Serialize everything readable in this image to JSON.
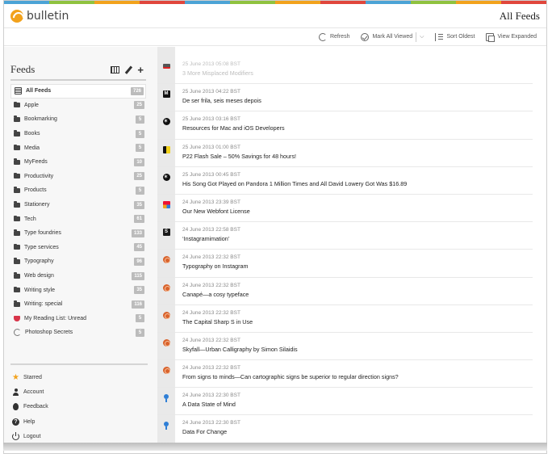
{
  "app": {
    "name": "bulletin",
    "page_title": "All Feeds",
    "stripe_colors": [
      "#4ba3d6",
      "#8fc23f",
      "#f2a21c",
      "#e0463c",
      "#4ba3d6",
      "#8fc23f",
      "#f2a21c",
      "#e0463c",
      "#4ba3d6",
      "#8fc23f",
      "#f2a21c",
      "#e0463c"
    ]
  },
  "toolbar": {
    "refresh": "Refresh",
    "mark_all_viewed": "Mark All Viewed",
    "sort_oldest": "Sort Oldest",
    "view_expanded": "View Expanded"
  },
  "sidebar": {
    "title": "Feeds",
    "items": [
      {
        "label": "All Feeds",
        "count": "726",
        "icon": "all-feeds-icon"
      },
      {
        "label": "Apple",
        "count": "25",
        "icon": "folder-icon"
      },
      {
        "label": "Bookmarking",
        "count": "5",
        "icon": "folder-icon"
      },
      {
        "label": "Books",
        "count": "5",
        "icon": "folder-icon"
      },
      {
        "label": "Media",
        "count": "5",
        "icon": "folder-icon"
      },
      {
        "label": "MyFeeds",
        "count": "10",
        "icon": "folder-icon"
      },
      {
        "label": "Productivity",
        "count": "25",
        "icon": "folder-icon"
      },
      {
        "label": "Products",
        "count": "5",
        "icon": "folder-icon"
      },
      {
        "label": "Stationery",
        "count": "35",
        "icon": "folder-icon"
      },
      {
        "label": "Tech",
        "count": "61",
        "icon": "folder-icon"
      },
      {
        "label": "Type foundries",
        "count": "133",
        "icon": "folder-icon"
      },
      {
        "label": "Type services",
        "count": "45",
        "icon": "folder-icon"
      },
      {
        "label": "Typography",
        "count": "96",
        "icon": "folder-icon"
      },
      {
        "label": "Web design",
        "count": "115",
        "icon": "folder-icon"
      },
      {
        "label": "Writing style",
        "count": "35",
        "icon": "folder-icon"
      },
      {
        "label": "Writing: special",
        "count": "116",
        "icon": "folder-icon"
      },
      {
        "label": "My Reading List: Unread",
        "count": "5",
        "icon": "pocket-icon"
      },
      {
        "label": "Photoshop Secrets",
        "count": "5",
        "icon": "photoshop-secrets-icon"
      }
    ],
    "bottom": [
      {
        "label": "Starred",
        "icon": "star-icon"
      },
      {
        "label": "Account",
        "icon": "account-icon"
      },
      {
        "label": "Feedback",
        "icon": "bug-icon"
      },
      {
        "label": "Help",
        "icon": "help-icon"
      },
      {
        "label": "Logout",
        "icon": "logout-icon"
      }
    ]
  },
  "articles": [
    {
      "date": "25 June 2013 05:08 BST",
      "title": "3 More Misplaced Modifiers",
      "icon": "wide-source-icon"
    },
    {
      "date": "25 June 2013 04:22 BST",
      "title": "De ser frila, seis meses depois",
      "icon": "m-source-icon"
    },
    {
      "date": "25 June 2013 03:16 BST",
      "title": "Resources for Mac and iOS Developers",
      "icon": "star-source-icon"
    },
    {
      "date": "25 June 2013 01:00 BST",
      "title": "P22 Flash Sale – 50% Savings for 48 hours!",
      "icon": "flag-source-icon"
    },
    {
      "date": "25 June 2013 00:45 BST",
      "title": "His Song Got Played on Pandora 1 Million Times and All David Lowery Got Was $16.89",
      "icon": "star-source-icon"
    },
    {
      "date": "24 June 2013 23:39 BST",
      "title": "Our New Webfont License",
      "icon": "multicolor-source-icon"
    },
    {
      "date": "24 June 2013 22:58 BST",
      "title": "‘Instagramimation’",
      "icon": "s-source-icon"
    },
    {
      "date": "24 June 2013 22:32 BST",
      "title": "Typography on Instagram",
      "icon": "type-source-icon"
    },
    {
      "date": "24 June 2013 22:32 BST",
      "title": "Canapé—a cosy typeface",
      "icon": "type-source-icon"
    },
    {
      "date": "24 June 2013 22:32 BST",
      "title": "The Capital Sharp S in Use",
      "icon": "type-source-icon"
    },
    {
      "date": "24 June 2013 22:32 BST",
      "title": "Skyfall—Urban Calligraphy by Simon Silaidis",
      "icon": "type-source-icon"
    },
    {
      "date": "24 June 2013 22:32 BST",
      "title": "From signs to minds—Can cartographic signs be superior to regular direction signs?",
      "icon": "type-source-icon"
    },
    {
      "date": "24 June 2013 22:30 BST",
      "title": "A Data State of Mind",
      "icon": "pin-source-icon"
    },
    {
      "date": "24 June 2013 22:30 BST",
      "title": "Data For Change",
      "icon": "pin-source-icon"
    }
  ]
}
